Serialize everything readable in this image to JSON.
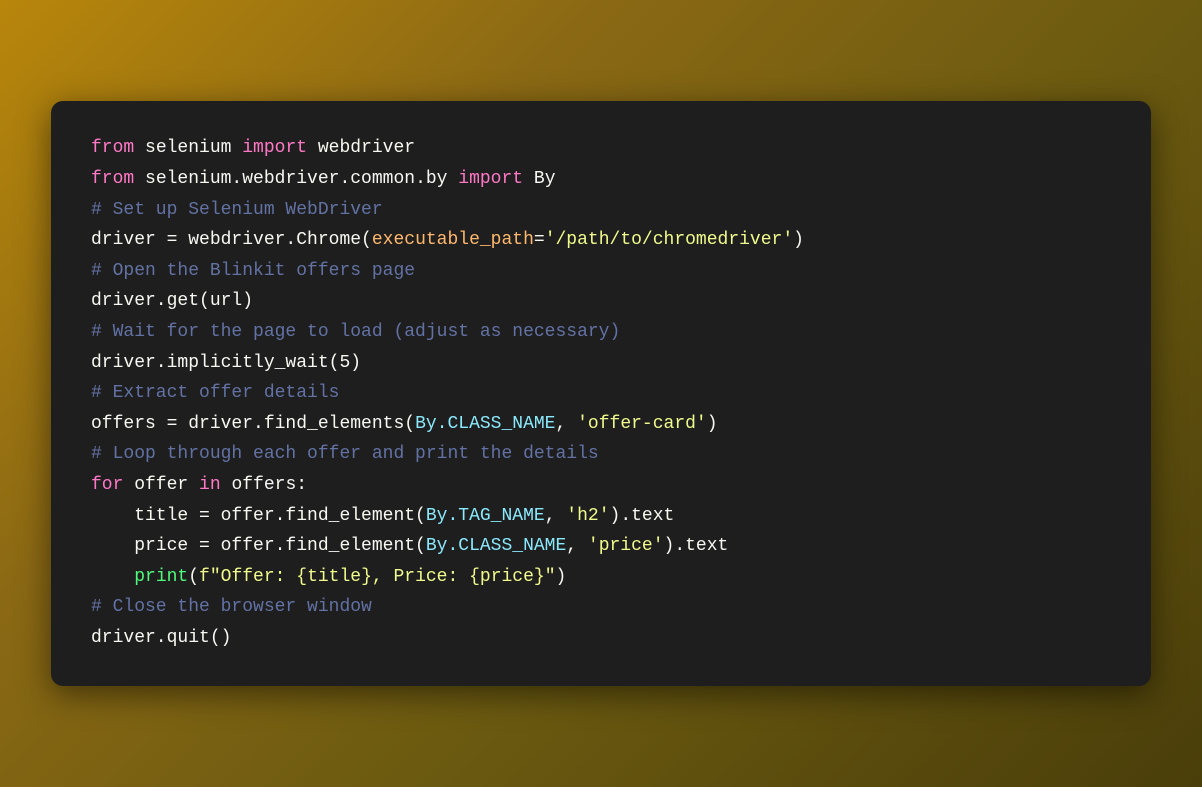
{
  "code": {
    "lines": [
      {
        "id": "line1",
        "tokens": [
          {
            "type": "kw-from",
            "text": "from"
          },
          {
            "type": "normal",
            "text": " selenium "
          },
          {
            "type": "kw-import",
            "text": "import"
          },
          {
            "type": "normal",
            "text": " webdriver"
          }
        ]
      },
      {
        "id": "line2",
        "tokens": [
          {
            "type": "kw-from",
            "text": "from"
          },
          {
            "type": "normal",
            "text": " selenium.webdriver.common.by "
          },
          {
            "type": "kw-import",
            "text": "import"
          },
          {
            "type": "normal",
            "text": " By"
          }
        ]
      },
      {
        "id": "line3",
        "tokens": [
          {
            "type": "comment",
            "text": "# Set up Selenium WebDriver"
          }
        ]
      },
      {
        "id": "line4",
        "tokens": [
          {
            "type": "normal",
            "text": "driver = webdriver.Chrome("
          },
          {
            "type": "param",
            "text": "executable_path"
          },
          {
            "type": "normal",
            "text": "="
          },
          {
            "type": "str",
            "text": "'/path/to/chromedriver'"
          },
          {
            "type": "normal",
            "text": ")"
          }
        ]
      },
      {
        "id": "line5",
        "tokens": [
          {
            "type": "comment",
            "text": "# Open the Blinkit offers page"
          }
        ]
      },
      {
        "id": "line6",
        "tokens": [
          {
            "type": "normal",
            "text": "driver.get(url)"
          }
        ]
      },
      {
        "id": "line7",
        "tokens": [
          {
            "type": "comment",
            "text": "# Wait for the page to load (adjust as necessary)"
          }
        ]
      },
      {
        "id": "line8",
        "tokens": [
          {
            "type": "normal",
            "text": "driver.implicitly_wait(5)"
          }
        ]
      },
      {
        "id": "line9",
        "tokens": [
          {
            "type": "comment",
            "text": "# Extract offer details"
          }
        ]
      },
      {
        "id": "line10",
        "tokens": [
          {
            "type": "normal",
            "text": "offers = driver.find_elements("
          },
          {
            "type": "cls",
            "text": "By.CLASS_NAME"
          },
          {
            "type": "normal",
            "text": ", "
          },
          {
            "type": "str",
            "text": "'offer-card'"
          },
          {
            "type": "normal",
            "text": ")"
          }
        ]
      },
      {
        "id": "line11",
        "tokens": [
          {
            "type": "comment",
            "text": "# Loop through each offer and print the details"
          }
        ]
      },
      {
        "id": "line12",
        "tokens": [
          {
            "type": "kw-from",
            "text": "for"
          },
          {
            "type": "normal",
            "text": " offer "
          },
          {
            "type": "kw-in",
            "text": "in"
          },
          {
            "type": "normal",
            "text": " offers:"
          }
        ]
      },
      {
        "id": "line13",
        "tokens": [
          {
            "type": "normal",
            "text": "    title = offer.find_element("
          },
          {
            "type": "cls",
            "text": "By.TAG_NAME"
          },
          {
            "type": "normal",
            "text": ", "
          },
          {
            "type": "str",
            "text": "'h2'"
          },
          {
            "type": "normal",
            "text": ").text"
          }
        ]
      },
      {
        "id": "line14",
        "tokens": [
          {
            "type": "normal",
            "text": "    price = offer.find_element("
          },
          {
            "type": "cls",
            "text": "By.CLASS_NAME"
          },
          {
            "type": "normal",
            "text": ", "
          },
          {
            "type": "str",
            "text": "'price'"
          },
          {
            "type": "normal",
            "text": ").text"
          }
        ]
      },
      {
        "id": "line15",
        "tokens": [
          {
            "type": "normal",
            "text": "    "
          },
          {
            "type": "kw-print",
            "text": "print"
          },
          {
            "type": "normal",
            "text": "("
          },
          {
            "type": "fstring",
            "text": "f\"Offer: {title}, Price: {price}\""
          },
          {
            "type": "normal",
            "text": ")"
          }
        ]
      },
      {
        "id": "line16",
        "tokens": [
          {
            "type": "comment",
            "text": "# Close the browser window"
          }
        ]
      },
      {
        "id": "line17",
        "tokens": [
          {
            "type": "normal",
            "text": "driver.quit()"
          }
        ]
      }
    ]
  }
}
